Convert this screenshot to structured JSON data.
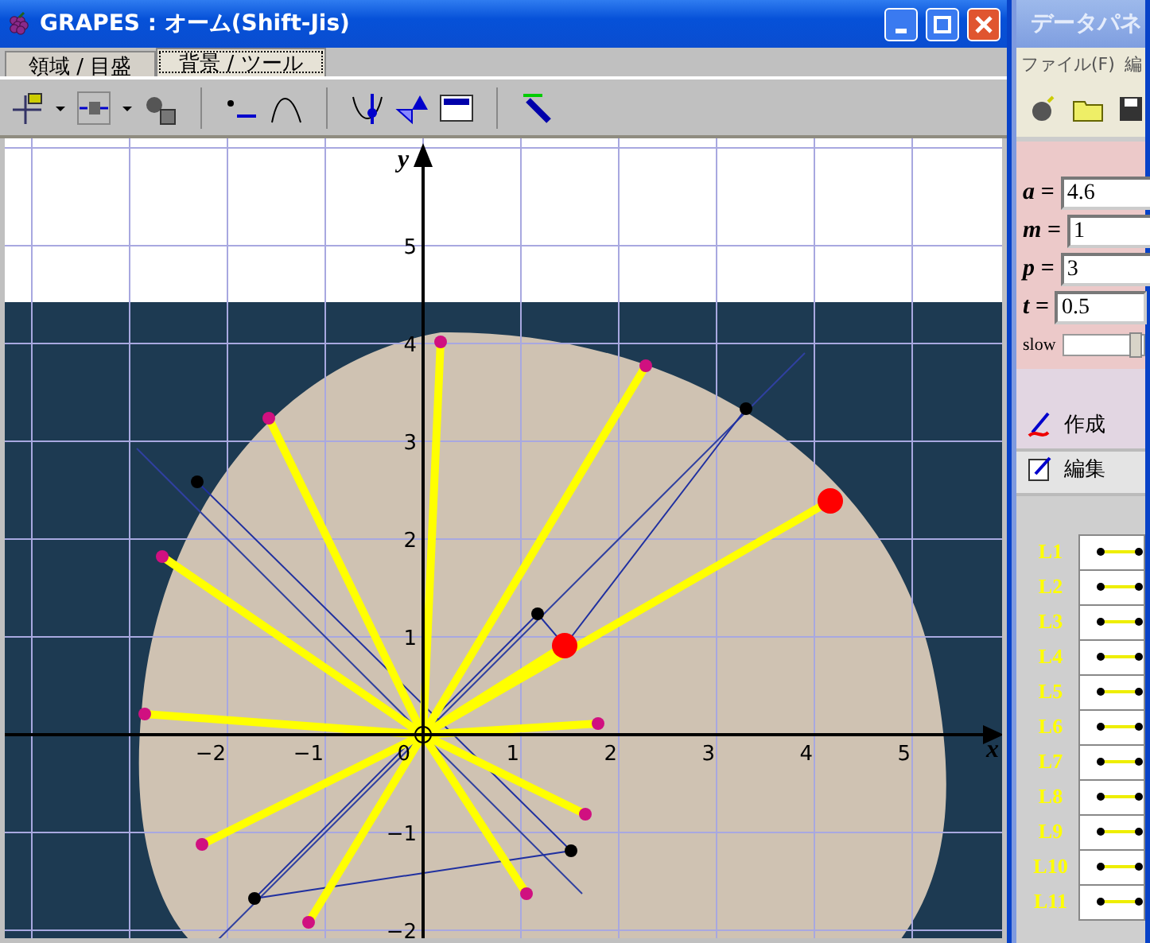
{
  "main_window": {
    "title": "GRAPES : オーム(Shift-Jis)",
    "tabs": [
      {
        "label": "領域 / 目盛",
        "selected": false
      },
      {
        "label": "背景 / ツール",
        "selected": true
      }
    ]
  },
  "graph": {
    "x_axis_label": "x",
    "y_axis_label": "y",
    "x_tick_labels": [
      "−2",
      "−1",
      "0",
      "1",
      "2",
      "3",
      "4",
      "5"
    ],
    "y_tick_labels": [
      "5",
      "4",
      "3",
      "2",
      "1",
      "−1",
      "−2"
    ]
  },
  "data_panel": {
    "title": "データパネ",
    "menu": [
      "ファイル(F)",
      "編"
    ],
    "parameters": [
      {
        "name": "a =",
        "value": "4.6"
      },
      {
        "name": "m =",
        "value": "1"
      },
      {
        "name": "p =",
        "value": "3"
      },
      {
        "name": "t =",
        "value": "0.5"
      }
    ],
    "speed_label": "slow",
    "speed": {
      "level": 0.9
    },
    "create_label": "作成",
    "edit_label": "編集",
    "lines": [
      "L1",
      "L2",
      "L3",
      "L4",
      "L5",
      "L6",
      "L7",
      "L8",
      "L9",
      "L10",
      "L11"
    ]
  }
}
